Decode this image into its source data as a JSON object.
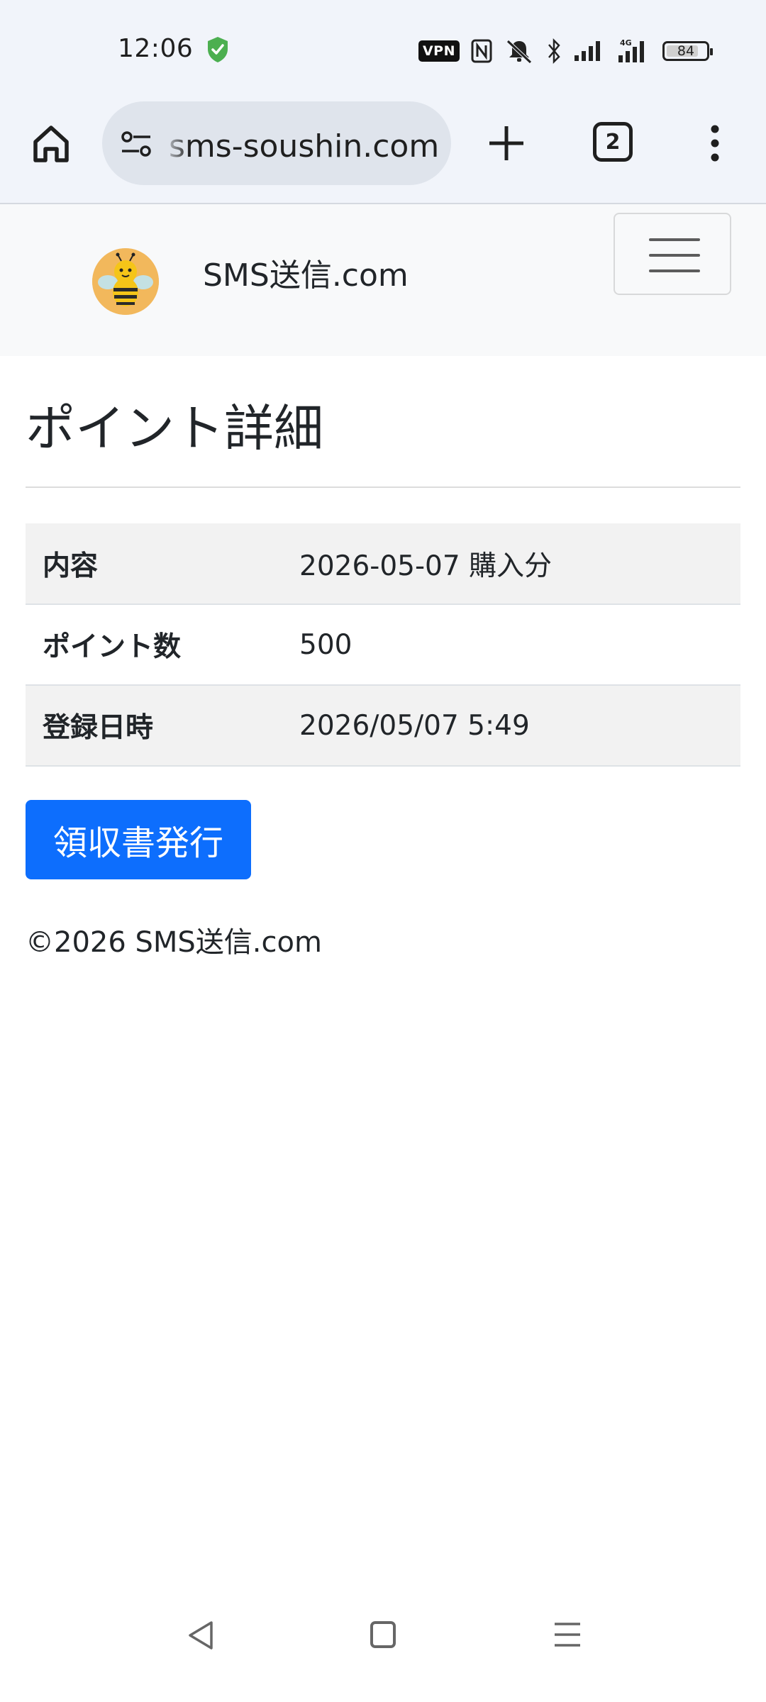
{
  "status_bar": {
    "time": "12:06",
    "vpn": "VPN",
    "battery": "84",
    "battery_level": 0.84,
    "network": "4G"
  },
  "browser": {
    "url": "sms-soushin.com",
    "tab_count": "2"
  },
  "navbar": {
    "brand": "SMS送信.com"
  },
  "page": {
    "title": "ポイント詳細",
    "rows": [
      {
        "label": "内容",
        "value": "2026-05-07 購入分"
      },
      {
        "label": "ポイント数",
        "value": "500"
      },
      {
        "label": "登録日時",
        "value": "2026/05/07 5:49"
      }
    ],
    "receipt_button": "領収書発行",
    "footer": "©2026 SMS送信.com"
  },
  "colors": {
    "primary": "#0d6efd",
    "shield": "#4caf50",
    "navbar_bg": "#f8f9fa"
  }
}
